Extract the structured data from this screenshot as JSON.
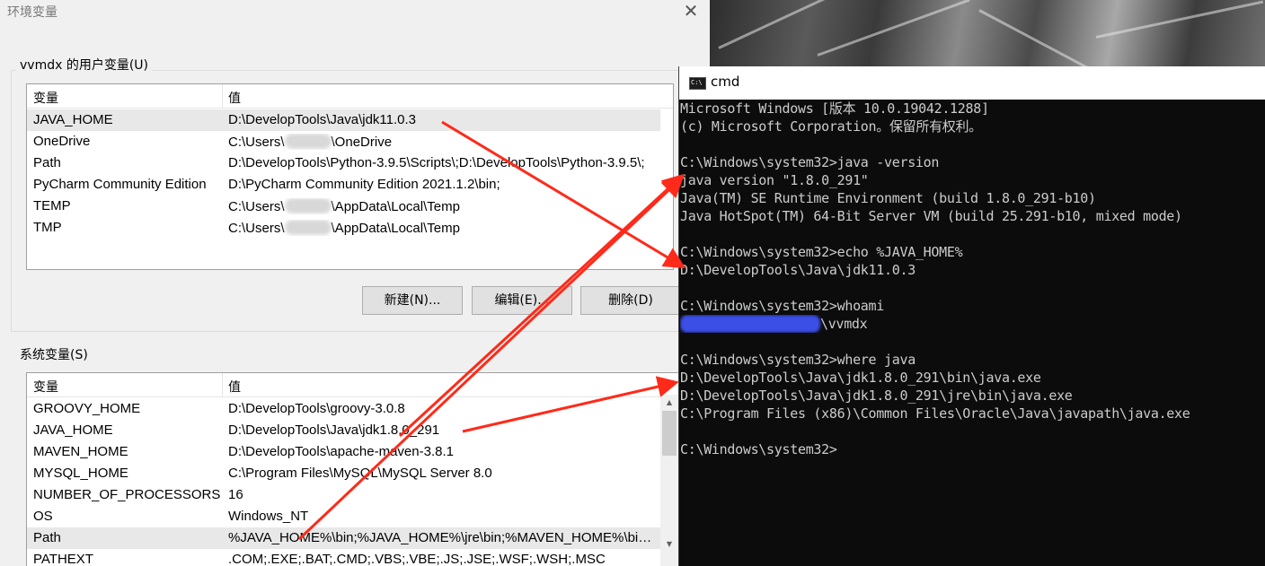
{
  "env_dialog": {
    "title": "环境变量",
    "close_glyph": "✕",
    "user_group_label": "vvmdx 的用户变量(U)",
    "system_group_label": "系统变量(S)",
    "columns": {
      "name": "变量",
      "value": "值"
    },
    "user_vars": [
      {
        "name": "JAVA_HOME",
        "value": "D:\\DevelopTools\\Java\\jdk11.0.3",
        "selected": true
      },
      {
        "name": "OneDrive",
        "value_prefix": "C:\\Users\\",
        "value_suffix": "\\OneDrive",
        "redacted": true
      },
      {
        "name": "Path",
        "value": "D:\\DevelopTools\\Python-3.9.5\\Scripts\\;D:\\DevelopTools\\Python-3.9.5\\;"
      },
      {
        "name": "PyCharm Community Edition",
        "value": "D:\\PyCharm Community Edition 2021.1.2\\bin;"
      },
      {
        "name": "TEMP",
        "value_prefix": "C:\\Users\\",
        "value_suffix": "\\AppData\\Local\\Temp",
        "redacted": true
      },
      {
        "name": "TMP",
        "value_prefix": "C:\\Users\\",
        "value_suffix": "\\AppData\\Local\\Temp",
        "redacted": true
      }
    ],
    "buttons": {
      "new": "新建(N)...",
      "edit": "编辑(E)...",
      "delete": "删除(D)"
    },
    "system_vars": [
      {
        "name": "GROOVY_HOME",
        "value": "D:\\DevelopTools\\groovy-3.0.8"
      },
      {
        "name": "JAVA_HOME",
        "value": "D:\\DevelopTools\\Java\\jdk1.8.0_291"
      },
      {
        "name": "MAVEN_HOME",
        "value": "D:\\DevelopTools\\apache-maven-3.8.1"
      },
      {
        "name": "MYSQL_HOME",
        "value": "C:\\Program Files\\MySQL\\MySQL Server 8.0"
      },
      {
        "name": "NUMBER_OF_PROCESSORS",
        "value": "16"
      },
      {
        "name": "OS",
        "value": "Windows_NT"
      },
      {
        "name": "Path",
        "value": "%JAVA_HOME%\\bin;%JAVA_HOME%\\jre\\bin;%MAVEN_HOME%\\bin;%MYSQL_HOME%\\bin;",
        "selected": true
      },
      {
        "name": "PATHEXT",
        "value": ".COM;.EXE;.BAT;.CMD;.VBS;.VBE;.JS;.JSE;.WSF;.WSH;.MSC"
      }
    ]
  },
  "cmd_window": {
    "title": "cmd",
    "icon_label": "C:\\",
    "lines": [
      "Microsoft Windows [版本 10.0.19042.1288]",
      "(c) Microsoft Corporation。保留所有权利。",
      "",
      "C:\\Windows\\system32>java -version",
      "java version \"1.8.0_291\"",
      "Java(TM) SE Runtime Environment (build 1.8.0_291-b10)",
      "Java HotSpot(TM) 64-Bit Server VM (build 25.291-b10, mixed mode)",
      "",
      "C:\\Windows\\system32>echo %JAVA_HOME%",
      "D:\\DevelopTools\\Java\\jdk11.0.3",
      "",
      "C:\\Windows\\system32>whoami",
      "\\vvmdx",
      "",
      "C:\\Windows\\system32>where java",
      "D:\\DevelopTools\\Java\\jdk1.8.0_291\\bin\\java.exe",
      "D:\\DevelopTools\\Java\\jdk1.8.0_291\\jre\\bin\\java.exe",
      "C:\\Program Files (x86)\\Common Files\\Oracle\\Java\\javapath\\java.exe",
      "",
      "C:\\Windows\\system32>"
    ],
    "redacted_line_index": 12
  },
  "colors": {
    "dialog_bg": "#f0f0f0",
    "cmd_bg": "#0c0c0c",
    "cmd_text": "#cccccc",
    "annotation_arrow": "#ff2a1a",
    "redaction_blue": "#3b4ee6"
  }
}
